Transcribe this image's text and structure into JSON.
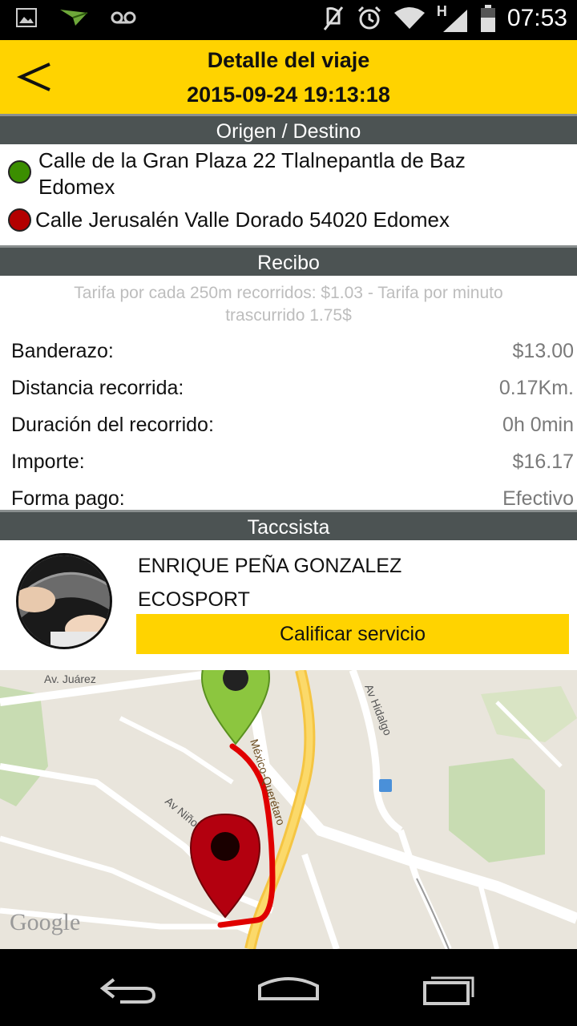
{
  "status_bar": {
    "time": "07:53",
    "network_letter": "H",
    "icons": [
      "image-icon",
      "send-icon",
      "voicemail-icon",
      "mute-icon",
      "alarm-icon",
      "wifi-icon",
      "signal-icon",
      "battery-icon"
    ]
  },
  "header": {
    "title": "Detalle del viaje",
    "date": "2015-09-24 19:13:18",
    "back_icon": "chevron-left-icon",
    "background": "#FFD300"
  },
  "route": {
    "section_title": "Origen / Destino",
    "origin": "Calle de la Gran Plaza 22  Tlalnepantla de Baz Edomex",
    "destination": "Calle Jerusalén Valle Dorado 54020 Edomex",
    "origin_color": "#3B8E00",
    "destination_color": "#B30000"
  },
  "receipt": {
    "section_title": "Recibo",
    "fare_note": "Tarifa por cada 250m recorridos: $1.03 - Tarifa por minuto trascurrido 1.75$",
    "rows": [
      {
        "label": "Banderazo:",
        "value": "$13.00"
      },
      {
        "label": "Distancia recorrida:",
        "value": "0.17Km."
      },
      {
        "label": "Duración del recorrido:",
        "value": "0h 0min"
      },
      {
        "label": "Importe:",
        "value": "$16.17"
      },
      {
        "label": "Forma pago:",
        "value": "Efectivo"
      }
    ]
  },
  "driver": {
    "section_title": "Taccsista",
    "name": "ENRIQUE PEÑA GONZALEZ",
    "car": "ECOSPORT",
    "rate_button": "Calificar servicio"
  },
  "map": {
    "labels": {
      "juarez": "Av. Juárez",
      "hidalgo": "Av Hidalgo",
      "ninos": "Av Niños",
      "highway": "México-Querétaro",
      "attribution": "Google"
    }
  },
  "colors": {
    "accent": "#FFD300",
    "section_header": "#4C5353",
    "route_line": "#E00000"
  }
}
